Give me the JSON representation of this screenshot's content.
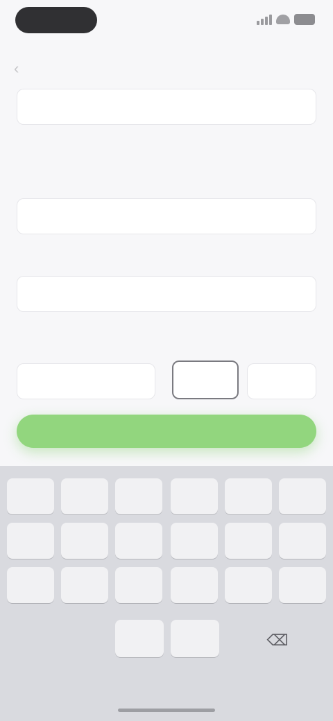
{
  "status_bar": {
    "time": ""
  },
  "header": {
    "back_icon": "chevron-left-icon",
    "title": ""
  },
  "top_field": {
    "value": ""
  },
  "section_one": {
    "title": "",
    "description": "",
    "input_value": ""
  },
  "section_two": {
    "title": "",
    "input_value": ""
  },
  "section_three": {
    "title": "",
    "start_label": "",
    "end_label": "",
    "start_value": "",
    "end_value": "",
    "right_value": ""
  },
  "confirm_button": {
    "label": ""
  },
  "colors": {
    "accent": "#92d67e",
    "background": "#f7f7f9",
    "keyboard": "#d9dadf"
  },
  "keyboard": {
    "rows": [
      [
        "",
        "",
        "",
        "",
        "",
        ""
      ],
      [
        "",
        "",
        "",
        "",
        "",
        ""
      ],
      [
        "",
        "",
        "",
        "",
        "",
        ""
      ],
      [
        "",
        "",
        ""
      ]
    ],
    "delete_icon": "backspace-icon"
  }
}
